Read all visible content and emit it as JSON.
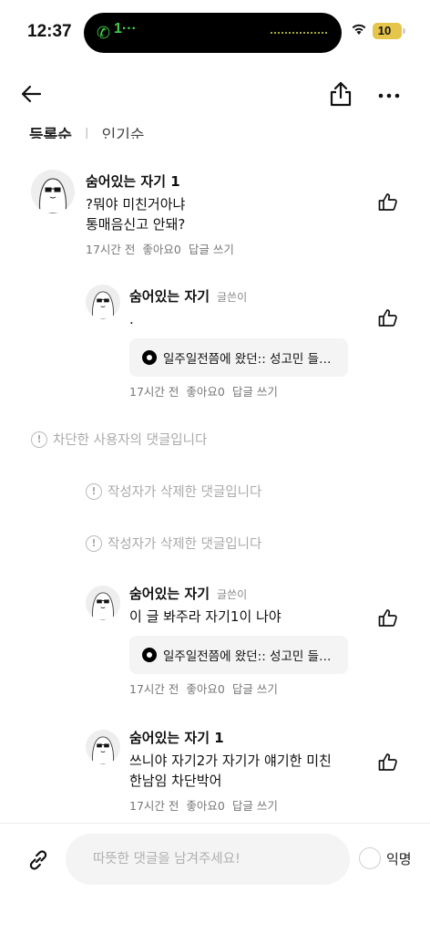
{
  "status_bar": {
    "time": "12:37",
    "call_text": "1···",
    "battery": "10",
    "call_icon": "phone-icon",
    "wifi_icon": "wifi-icon"
  },
  "nav": {
    "back_icon": "arrow-left-icon",
    "share_icon": "share-icon",
    "more_icon": "ellipsis-icon"
  },
  "sort": {
    "active": "등록순",
    "other": "인기순"
  },
  "comments": [
    {
      "author": "숨어있는 자기 1",
      "badge": "",
      "text": "?뭐야 미친거아냐\n통매음신고 안돼?",
      "time": "17시간 전",
      "likes": "좋아요0",
      "reply": "답글 쓰기"
    },
    {
      "author": "숨어있는 자기",
      "badge": "글쓴이",
      "text": ".",
      "attachment": "일주일전쯤에 왔던:: 성고민 들…",
      "time": "17시간 전",
      "likes": "좋아요0",
      "reply": "답글 쓰기"
    },
    {
      "author": "숨어있는 자기",
      "badge": "글쓴이",
      "text": "이 글 봐주라 자기1이 나야",
      "attachment": "일주일전쯤에 왔던:: 성고민 들…",
      "time": "17시간 전",
      "likes": "좋아요0",
      "reply": "답글 쓰기"
    },
    {
      "author": "숨어있는 자기 1",
      "badge": "",
      "text": "쓰니야 자기2가 자기가 얘기한 미친\n한남임 차단박어",
      "time": "17시간 전",
      "likes": "좋아요0",
      "reply": "답글 쓰기"
    }
  ],
  "removed": {
    "blocked": "차단한 사용자의 댓글입니다",
    "deleted_1": "작성자가 삭제한 댓글입니다",
    "deleted_2": "작성자가 삭제한 댓글입니다"
  },
  "input": {
    "placeholder": "따뜻한 댓글을 남겨주세요!",
    "value": "",
    "anonymous_label": "익명"
  },
  "colors": {
    "call_green": "#3fd14a",
    "battery_yellow": "#e5c54a",
    "muted_text": "#777777",
    "removed_text": "#aaaaaa"
  }
}
